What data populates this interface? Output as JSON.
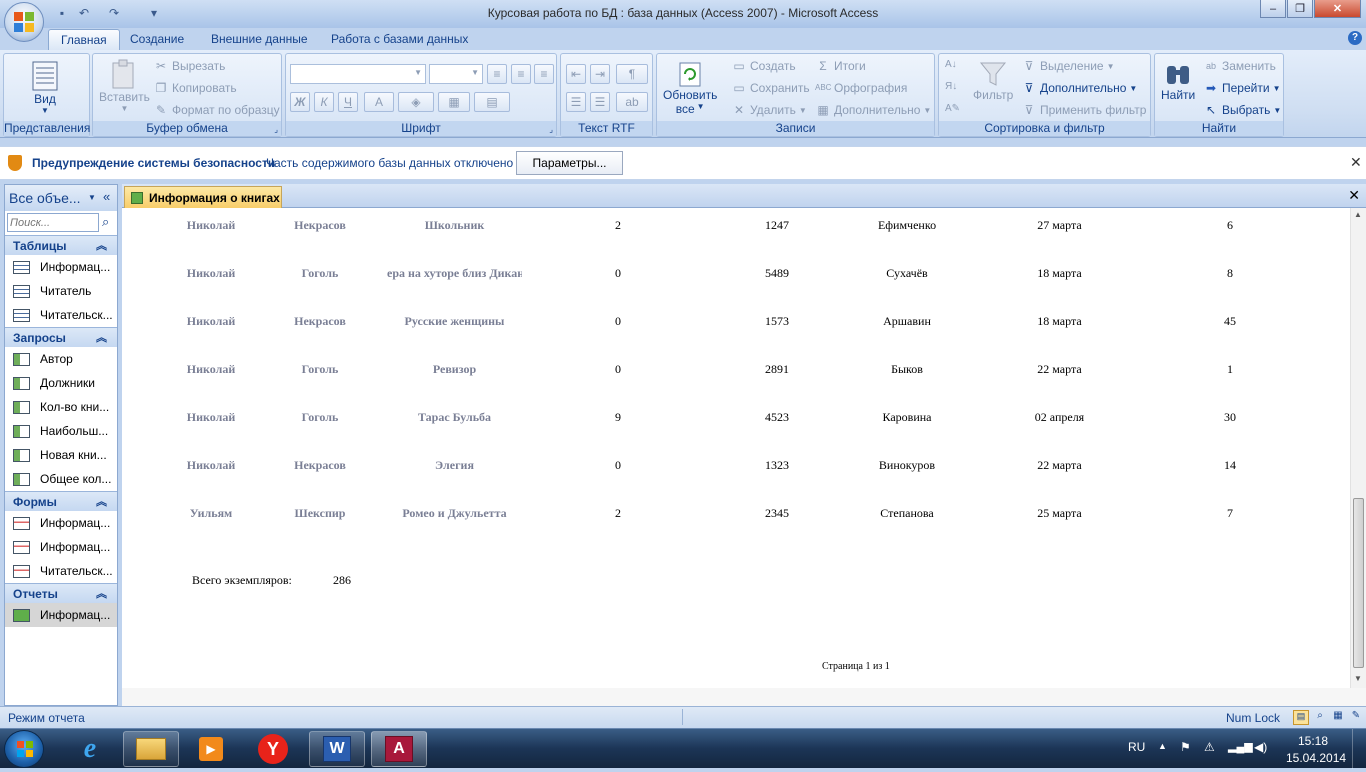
{
  "window": {
    "title": "Курсовая работа по БД : база данных (Access 2007)  -  Microsoft Access",
    "help": "?"
  },
  "tabs": [
    {
      "label": "Главная"
    },
    {
      "label": "Создание"
    },
    {
      "label": "Внешние данные"
    },
    {
      "label": "Работа с базами данных"
    }
  ],
  "ribbon": {
    "groups": {
      "views": "Представления",
      "clipboard": "Буфер обмена",
      "font": "Шрифт",
      "rtf": "Текст RTF",
      "records": "Записи",
      "sort": "Сортировка и фильтр",
      "find": "Найти"
    },
    "view": "Вид",
    "paste": "Вставить",
    "cut": "Вырезать",
    "copy": "Копировать",
    "format_painter": "Формат по образцу",
    "bold": "Ж",
    "italic": "К",
    "underline": "Ч",
    "font_color": "A",
    "refresh": "Обновить",
    "refresh_all": "все",
    "new": "Создать",
    "save": "Сохранить",
    "delete": "Удалить",
    "totals": "Итоги",
    "spelling": "Орфография",
    "more": "Дополнительно",
    "filter": "Фильтр",
    "selection": "Выделение",
    "advanced": "Дополнительно",
    "apply_filter": "Применить фильтр",
    "find": "Найти",
    "replace": "Заменить",
    "goto": "Перейти",
    "select": "Выбрать"
  },
  "security": {
    "title": "Предупреждение системы безопасности",
    "message": "Часть содержимого базы данных отключено",
    "button": "Параметры..."
  },
  "nav": {
    "title": "Все объе...",
    "search_placeholder": "Поиск...",
    "sections": [
      {
        "label": "Таблицы",
        "items": [
          "Информац...",
          "Читатель",
          "Читательск..."
        ]
      },
      {
        "label": "Запросы",
        "items": [
          "Автор",
          "Должники",
          "Кол-во кни...",
          "Наибольш...",
          "Новая кни...",
          "Общее кол..."
        ]
      },
      {
        "label": "Формы",
        "items": [
          "Информац...",
          "Информац...",
          "Читательск..."
        ]
      },
      {
        "label": "Отчеты",
        "items": [
          "Информац..."
        ]
      }
    ]
  },
  "document": {
    "tab_label": "Информация о книгах",
    "rows": [
      [
        "Николай",
        "Некрасов",
        "Школьник",
        "2",
        "1247",
        "Ефимченко",
        "27 марта",
        "6"
      ],
      [
        "Николай",
        "Гоголь",
        "ера на хуторе близ Дикан",
        "0",
        "5489",
        "Сухачёв",
        "18 марта",
        "8"
      ],
      [
        "Николай",
        "Некрасов",
        "Русские женщины",
        "0",
        "1573",
        "Аршавин",
        "18 марта",
        "45"
      ],
      [
        "Николай",
        "Гоголь",
        "Ревизор",
        "0",
        "2891",
        "Быков",
        "22 марта",
        "1"
      ],
      [
        "Николай",
        "Гоголь",
        "Тарас Бульба",
        "9",
        "4523",
        "Каровина",
        "02 апреля",
        "30"
      ],
      [
        "Николай",
        "Некрасов",
        "Элегия",
        "0",
        "1323",
        "Винокуров",
        "22 марта",
        "14"
      ],
      [
        "Уильям",
        "Шекспир",
        "Ромео и Джульетта",
        "2",
        "2345",
        "Степанова",
        "25 марта",
        "7"
      ]
    ],
    "total_label": "Всего экземпляров:",
    "total_value": "286",
    "page_label": "Страница 1 из 1"
  },
  "status": {
    "mode": "Режим отчета",
    "numlock": "Num Lock"
  },
  "taskbar": {
    "lang": "RU",
    "time": "15:18",
    "date": "15.04.2014"
  },
  "colors": {
    "accent": "#15428b",
    "report_tab": "#f8cd6a",
    "muted_text": "#7a7f95"
  }
}
